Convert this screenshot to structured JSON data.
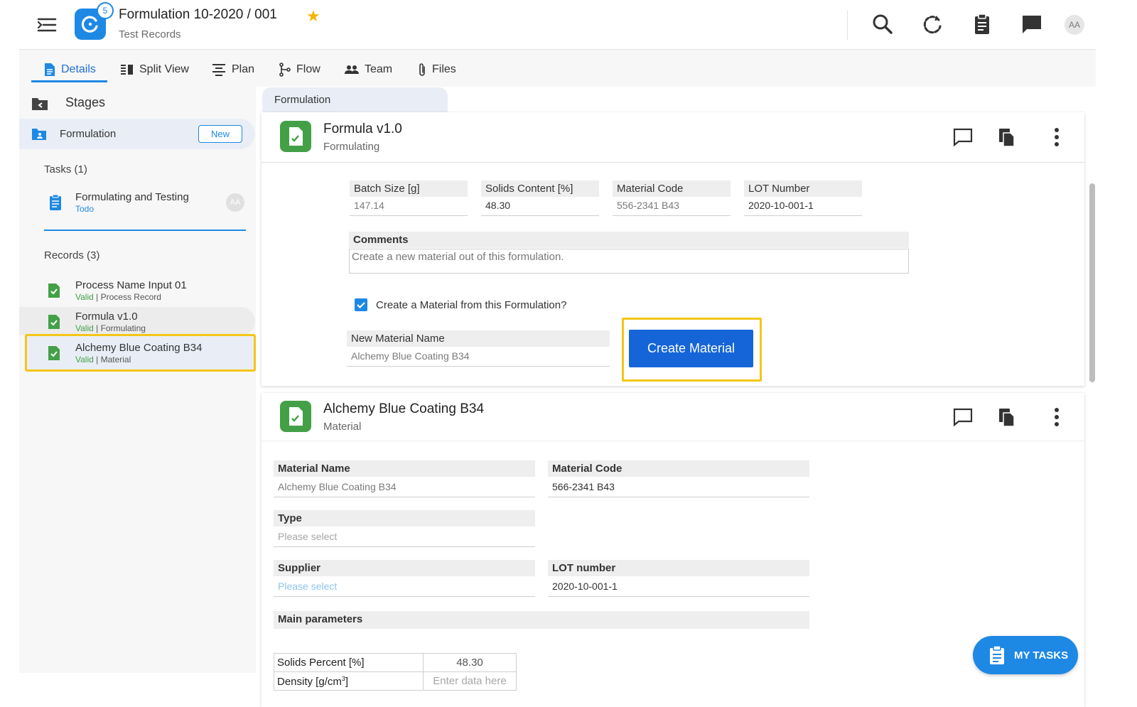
{
  "header": {
    "title": "Formulation 10-2020 / 001",
    "subtitle": "Test Records",
    "logo_badge": "5",
    "avatar_initials": "AA",
    "starred": true
  },
  "tabs": [
    {
      "label": "Details",
      "icon": "document-icon",
      "active": true
    },
    {
      "label": "Split View",
      "icon": "split-view-icon"
    },
    {
      "label": "Plan",
      "icon": "plan-icon"
    },
    {
      "label": "Flow",
      "icon": "flow-icon"
    },
    {
      "label": "Team",
      "icon": "team-icon"
    },
    {
      "label": "Files",
      "icon": "paperclip-icon"
    }
  ],
  "sidebar": {
    "stages_label": "Stages",
    "stage": {
      "label": "Formulation",
      "badge": "New"
    },
    "tasks_heading": "Tasks (1)",
    "task": {
      "title": "Formulating and Testing",
      "status": "Todo",
      "assignee": "AA"
    },
    "records_heading": "Records (3)",
    "records": [
      {
        "title": "Process Name Input 01",
        "status": "Valid",
        "type": "| Process Record"
      },
      {
        "title": "Formula v1.0",
        "status": "Valid",
        "type": "| Formulating"
      },
      {
        "title": "Alchemy Blue Coating B34",
        "status": "Valid",
        "type": "| Material"
      }
    ]
  },
  "stage_tab": "Formulation",
  "formula_card": {
    "title": "Formula v1.0",
    "subtitle": "Formulating",
    "fields": [
      {
        "label": "Batch Size [g]",
        "value": "147.14"
      },
      {
        "label": "Solids Content [%]",
        "value": "48.30"
      },
      {
        "label": "Material Code",
        "value": "556-2341 B43"
      },
      {
        "label": "LOT Number",
        "value": "2020-10-001-1"
      }
    ],
    "comments_label": "Comments",
    "comments_value": "Create a new material out of this formulation.",
    "checkbox_label": "Create a Material from this Formulation?",
    "checkbox_checked": true,
    "new_material_label": "New Material Name",
    "new_material_value": "Alchemy Blue Coating B34",
    "create_button": "Create Material"
  },
  "material_card": {
    "title": "Alchemy Blue Coating B34",
    "subtitle": "Material",
    "material_name_label": "Material Name",
    "material_name_value": "Alchemy Blue Coating B34",
    "material_code_label": "Material Code",
    "material_code_value": "566-2341 B43",
    "type_label": "Type",
    "type_placeholder": "Please select",
    "supplier_label": "Supplier",
    "supplier_placeholder": "Please select",
    "lot_label": "LOT number",
    "lot_value": "2020-10-001-1",
    "main_params_label": "Main parameters",
    "params": [
      {
        "label": "Solids Percent [%]",
        "value": "48.30"
      },
      {
        "label": "Density [g/cm",
        "sup": "3",
        "label_end": "]",
        "placeholder": "Enter data here"
      }
    ]
  },
  "fab_label": "MY TASKS",
  "colors": {
    "accent": "#1e88e5",
    "highlight": "#f5c518",
    "valid": "#43a047",
    "doc_icon": "#43a047"
  }
}
